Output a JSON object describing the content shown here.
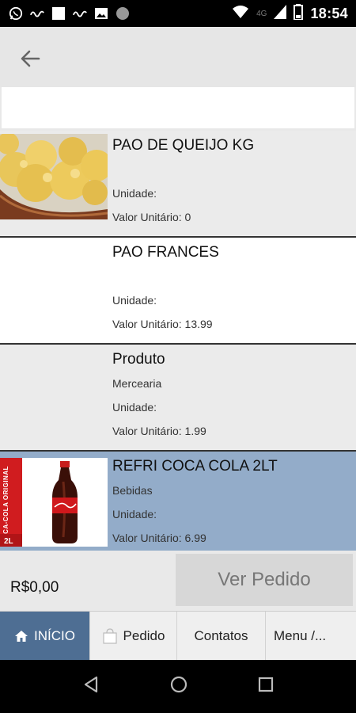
{
  "status_bar": {
    "time": "18:54",
    "network": "4G",
    "icons": [
      "whatsapp-icon",
      "ifood-icon",
      "square-icon",
      "ifood-icon",
      "gallery-icon",
      "circle-icon",
      "wifi-icon",
      "signal-icon",
      "battery-icon"
    ]
  },
  "app_bar": {
    "back_icon": "arrow-left-icon"
  },
  "search": {
    "value": "",
    "placeholder": ""
  },
  "products": [
    {
      "name": "PAO DE QUEIJO KG",
      "category": "",
      "unit_label": "Unidade:",
      "price_label": "Valor Unitário: 0",
      "image": "cheese-bread-photo"
    },
    {
      "name": "PAO FRANCES",
      "category": "",
      "unit_label": "Unidade:",
      "price_label": "Valor Unitário: 13.99",
      "image": ""
    },
    {
      "name": "Produto",
      "category": "Mercearia",
      "unit_label": "Unidade:",
      "price_label": "Valor Unitário: 1.99",
      "image": ""
    },
    {
      "name": "REFRI COCA COLA 2LT",
      "category": "Bebidas",
      "unit_label": "Unidade:",
      "price_label": "Valor Unitário: 6.99",
      "image": "coca-cola-bottle-photo",
      "image_side_text": "COCA-COLA ORIGINAL",
      "image_size_text": "2L",
      "selected": true
    }
  ],
  "footer": {
    "total": "R$0,00",
    "order_button": "Ver Pedido"
  },
  "bottom_nav": [
    {
      "label": "INÍCIO",
      "icon": "home-icon",
      "active": true
    },
    {
      "label": "Pedido",
      "icon": "bag-icon",
      "active": false
    },
    {
      "label": "Contatos",
      "icon": "",
      "active": false
    },
    {
      "label": "Menu /...",
      "icon": "",
      "active": false
    }
  ],
  "system_nav": [
    "back-triangle-icon",
    "home-circle-icon",
    "recents-square-icon"
  ],
  "colors": {
    "active_tab": "#4e6e93",
    "selected_row": "#93acc9",
    "coke_red": "#d01c1f"
  }
}
